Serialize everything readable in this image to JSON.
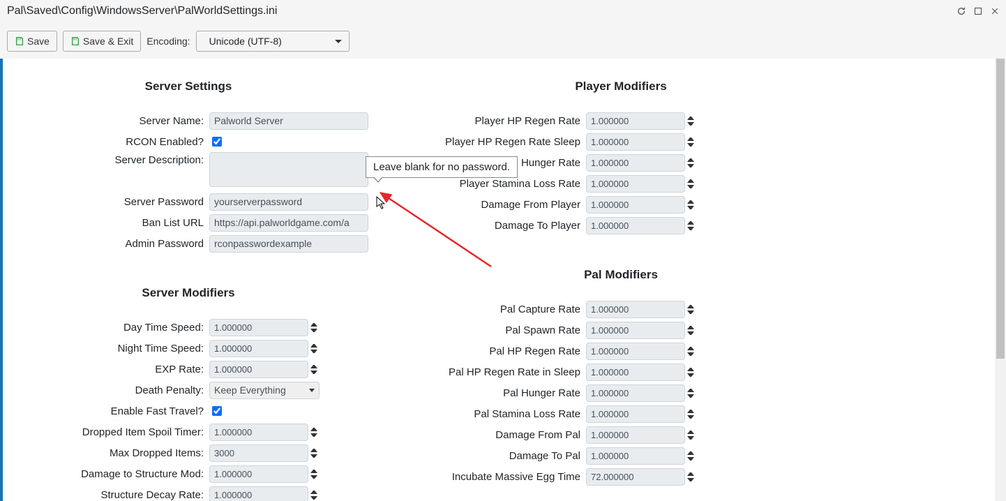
{
  "window": {
    "title": "Pal\\Saved\\Config\\WindowsServer\\PalWorldSettings.ini"
  },
  "toolbar": {
    "save": "Save",
    "save_exit": "Save & Exit",
    "encoding_label": "Encoding:",
    "encoding_value": "Unicode (UTF-8)"
  },
  "tooltip_text": "Leave blank for no password.",
  "server_settings": {
    "title": "Server Settings",
    "server_name_label": "Server Name:",
    "server_name_value": "Palworld Server",
    "rcon_enabled_label": "RCON Enabled?",
    "rcon_enabled_checked": true,
    "server_desc_label": "Server Description:",
    "server_desc_value": "",
    "server_password_label": "Server Password",
    "server_password_value": "yourserverpassword",
    "ban_list_label": "Ban List URL",
    "ban_list_value": "https://api.palworldgame.com/a",
    "admin_password_label": "Admin Password",
    "admin_password_value": "rconpasswordexample"
  },
  "server_modifiers": {
    "title": "Server Modifiers",
    "day_time_label": "Day Time Speed:",
    "day_time_value": "1.000000",
    "night_time_label": "Night Time Speed:",
    "night_time_value": "1.000000",
    "exp_rate_label": "EXP Rate:",
    "exp_rate_value": "1.000000",
    "death_penalty_label": "Death Penalty:",
    "death_penalty_value": "Keep Everything",
    "fast_travel_label": "Enable Fast Travel?",
    "fast_travel_checked": true,
    "dropped_spoil_label": "Dropped Item Spoil Timer:",
    "dropped_spoil_value": "1.000000",
    "max_dropped_label": "Max Dropped Items:",
    "max_dropped_value": "3000",
    "dmg_structure_label": "Damage to Structure Mod:",
    "dmg_structure_value": "1.000000",
    "structure_decay_label": "Structure Decay Rate:",
    "structure_decay_value": "1.000000"
  },
  "player_modifiers": {
    "title": "Player Modifiers",
    "hp_regen_label": "Player HP Regen Rate",
    "hp_regen_value": "1.000000",
    "hp_regen_sleep_label": "Player HP Regen Rate Sleep",
    "hp_regen_sleep_value": "1.000000",
    "hunger_label": "Hunger Rate",
    "hunger_value": "1.000000",
    "stamina_label": "Player Stamina Loss Rate",
    "stamina_value": "1.000000",
    "dmg_from_label": "Damage From Player",
    "dmg_from_value": "1.000000",
    "dmg_to_label": "Damage To Player",
    "dmg_to_value": "1.000000"
  },
  "pal_modifiers": {
    "title": "Pal Modifiers",
    "capture_label": "Pal Capture Rate",
    "capture_value": "1.000000",
    "spawn_label": "Pal Spawn Rate",
    "spawn_value": "1.000000",
    "hp_regen_label": "Pal HP Regen Rate",
    "hp_regen_value": "1.000000",
    "hp_regen_sleep_label": "Pal HP Regen Rate in Sleep",
    "hp_regen_sleep_value": "1.000000",
    "hunger_label": "Pal Hunger Rate",
    "hunger_value": "1.000000",
    "stamina_label": "Pal Stamina Loss Rate",
    "stamina_value": "1.000000",
    "dmg_from_label": "Damage From Pal",
    "dmg_from_value": "1.000000",
    "dmg_to_label": "Damage To Pal",
    "dmg_to_value": "1.000000",
    "incubate_label": "Incubate Massive Egg Time",
    "incubate_value": "72.000000"
  }
}
